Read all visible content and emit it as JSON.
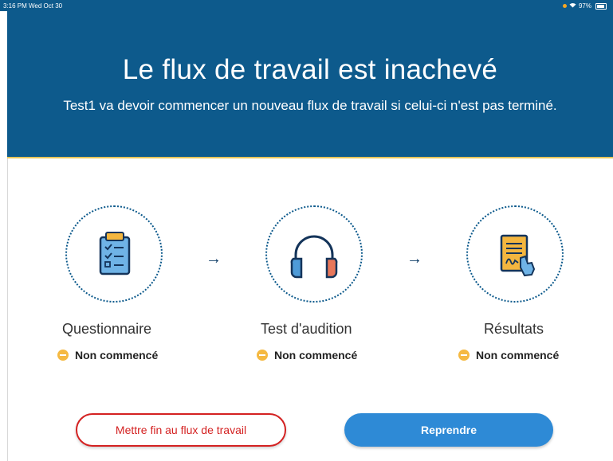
{
  "status_bar": {
    "time": "3:16 PM  Wed Oct 30",
    "battery": "97%"
  },
  "header": {
    "title": "Le flux de travail est inachevé",
    "subtitle": "Test1 va devoir commencer un nouveau flux de travail si celui-ci n'est pas terminé."
  },
  "steps": [
    {
      "label": "Questionnaire",
      "status": "Non commencé",
      "icon": "clipboard-checklist-icon"
    },
    {
      "label": "Test d'audition",
      "status": "Non commencé",
      "icon": "headphones-icon"
    },
    {
      "label": "Résultats",
      "status": "Non commencé",
      "icon": "signed-document-icon"
    }
  ],
  "buttons": {
    "end_workflow": "Mettre fin au flux de travail",
    "resume": "Reprendre"
  },
  "colors": {
    "header_bg": "#0d5a8c",
    "accent_line": "#e7c55a",
    "status_pending": "#f5b942",
    "danger": "#d42121",
    "primary": "#2e8ad6"
  }
}
